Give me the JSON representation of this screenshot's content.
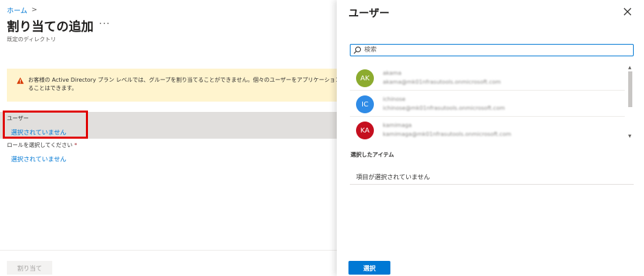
{
  "breadcrumb": {
    "home": "ホーム",
    "separator": ">"
  },
  "page": {
    "title": "割り当ての追加",
    "more": "···",
    "subtitle": "既定のディレクトリ"
  },
  "warning": {
    "line1": "お客様の Active Directory プラン レベルでは、グループを割り当てることができません。個々のユーザーをアプリケーションに割り当",
    "line2": "ることはできます。"
  },
  "users_field": {
    "label": "ユーザー",
    "value": "選択されていません"
  },
  "role_field": {
    "label": "ロールを選択してください",
    "required_mark": "*",
    "value": "選択されていません"
  },
  "footer": {
    "assign_label": "割り当て"
  },
  "panel": {
    "title": "ユーザー",
    "search_placeholder": "検索",
    "users": [
      {
        "initials": "AK",
        "name": "akama",
        "email": "akama@mk01nfrasutools.onmicrosoft.com",
        "color": "#8cab2f"
      },
      {
        "initials": "IC",
        "name": "ichinose",
        "email": "ichinose@mk01nfrasutools.onmicrosoft.com",
        "color": "#2f8be6"
      },
      {
        "initials": "KA",
        "name": "kamimaga",
        "email": "kamimaga@mk01nfrasutools.onmicrosoft.com",
        "color": "#c50f1f"
      }
    ],
    "selected_items_label": "選択したアイテム",
    "selected_items_empty": "項目が選択されていません",
    "select_button": "選択"
  },
  "colors": {
    "accent": "#0078d4",
    "highlight": "#e00000",
    "warning_bg": "#fff4ce"
  }
}
